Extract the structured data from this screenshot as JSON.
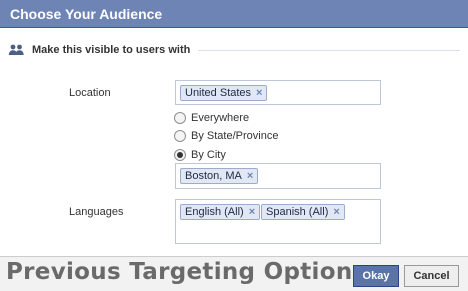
{
  "dialog": {
    "title": "Choose Your Audience"
  },
  "section": {
    "icon": "users-icon",
    "title": "Make this visible to users with"
  },
  "location": {
    "label": "Location",
    "tokens": [
      {
        "text": "United States",
        "remove": "×"
      }
    ],
    "options": [
      {
        "label": "Everywhere",
        "checked": false
      },
      {
        "label": "By State/Province",
        "checked": false
      },
      {
        "label": "By City",
        "checked": true
      }
    ],
    "city_tokens": [
      {
        "text": "Boston, MA",
        "remove": "×"
      }
    ]
  },
  "languages": {
    "label": "Languages",
    "tokens": [
      {
        "text": "English (All)",
        "remove": "×"
      },
      {
        "text": "Spanish (All)",
        "remove": "×"
      }
    ]
  },
  "footer": {
    "banner": "Previous Targeting Options",
    "okay_label": "Okay",
    "cancel_label": "Cancel"
  },
  "colors": {
    "titlebar": "#6d84b4",
    "token_bg": "#e2e8f3",
    "primary_button": "#5b74a8"
  }
}
